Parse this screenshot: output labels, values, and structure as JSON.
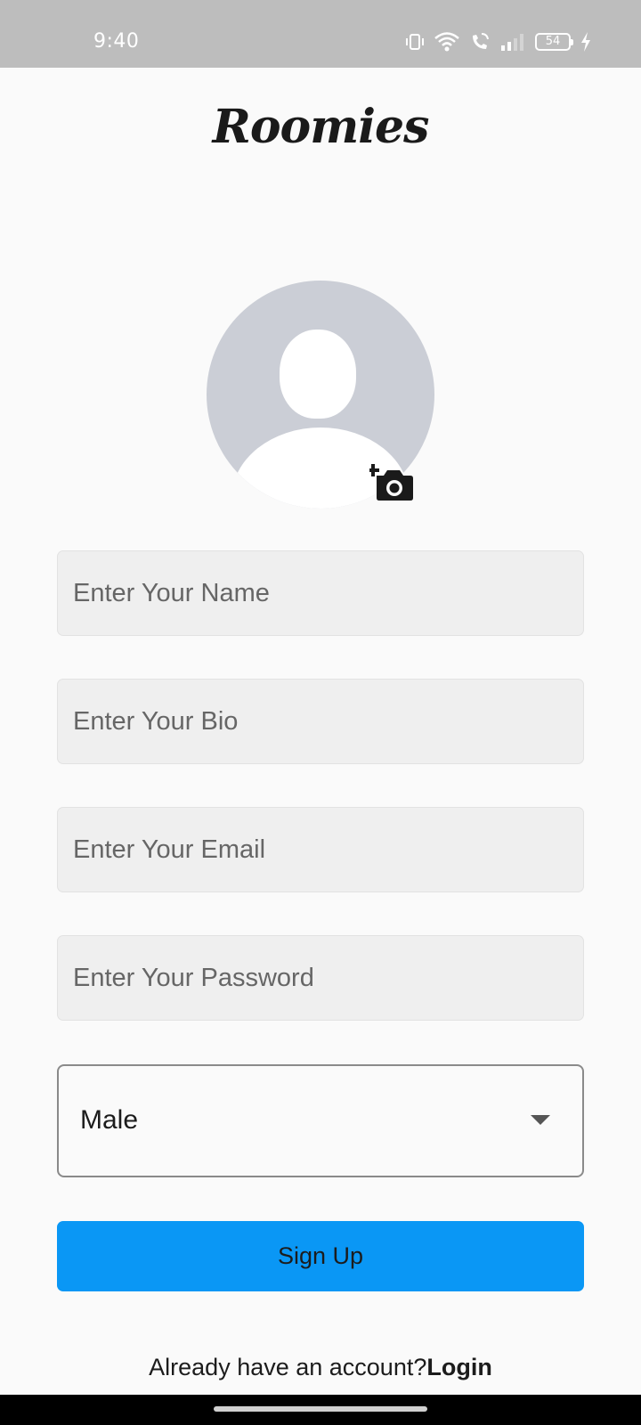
{
  "status_bar": {
    "time": "9:40",
    "battery_level": "54",
    "icons": [
      "vibrate-icon",
      "wifi-icon",
      "wifi-calling-icon",
      "signal-icon",
      "battery-icon",
      "charging-icon"
    ]
  },
  "app": {
    "logo_text": "Roomies"
  },
  "profile": {
    "avatar_icon": "default-avatar-icon",
    "add_photo_icon": "add-photo-camera-icon"
  },
  "form": {
    "name_placeholder": "Enter Your Name",
    "bio_placeholder": "Enter Your Bio",
    "email_placeholder": "Enter Your Email",
    "password_placeholder": "Enter Your Password",
    "gender": {
      "selected": "Male"
    },
    "signup_label": "Sign Up",
    "login_prompt": "Already have an account?",
    "login_link": "Login"
  },
  "colors": {
    "primary": "#0a97f5",
    "status_bar": "#bdbdbd",
    "field_bg": "#efefef",
    "avatar_bg": "#cbced6"
  }
}
